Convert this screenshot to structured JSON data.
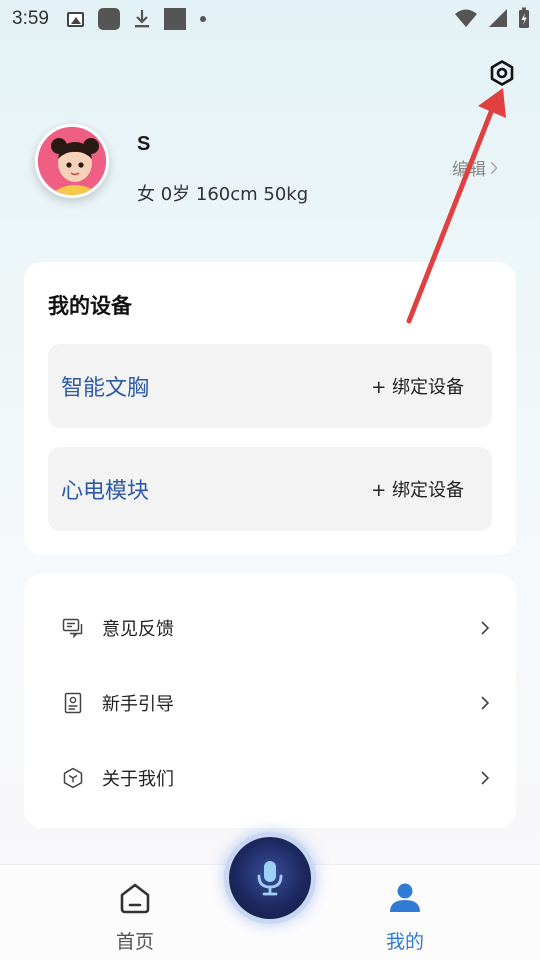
{
  "status_bar": {
    "time": "3:59"
  },
  "profile": {
    "name": "S",
    "info": "女 0岁 160cm 50kg",
    "edit_label": "编辑"
  },
  "devices": {
    "title": "我的设备",
    "items": [
      {
        "name": "智能文胸",
        "action": "+ 绑定设备"
      },
      {
        "name": "心电模块",
        "action": "+ 绑定设备"
      }
    ]
  },
  "menu": {
    "items": [
      {
        "label": "意见反馈",
        "icon": "feedback-icon"
      },
      {
        "label": "新手引导",
        "icon": "guide-icon"
      },
      {
        "label": "关于我们",
        "icon": "about-icon"
      }
    ]
  },
  "nav": {
    "home_label": "首页",
    "mine_label": "我的"
  },
  "colors": {
    "accent": "#2f7bd6",
    "device_name": "#2e5aa6",
    "annotation_arrow": "#e04040"
  }
}
